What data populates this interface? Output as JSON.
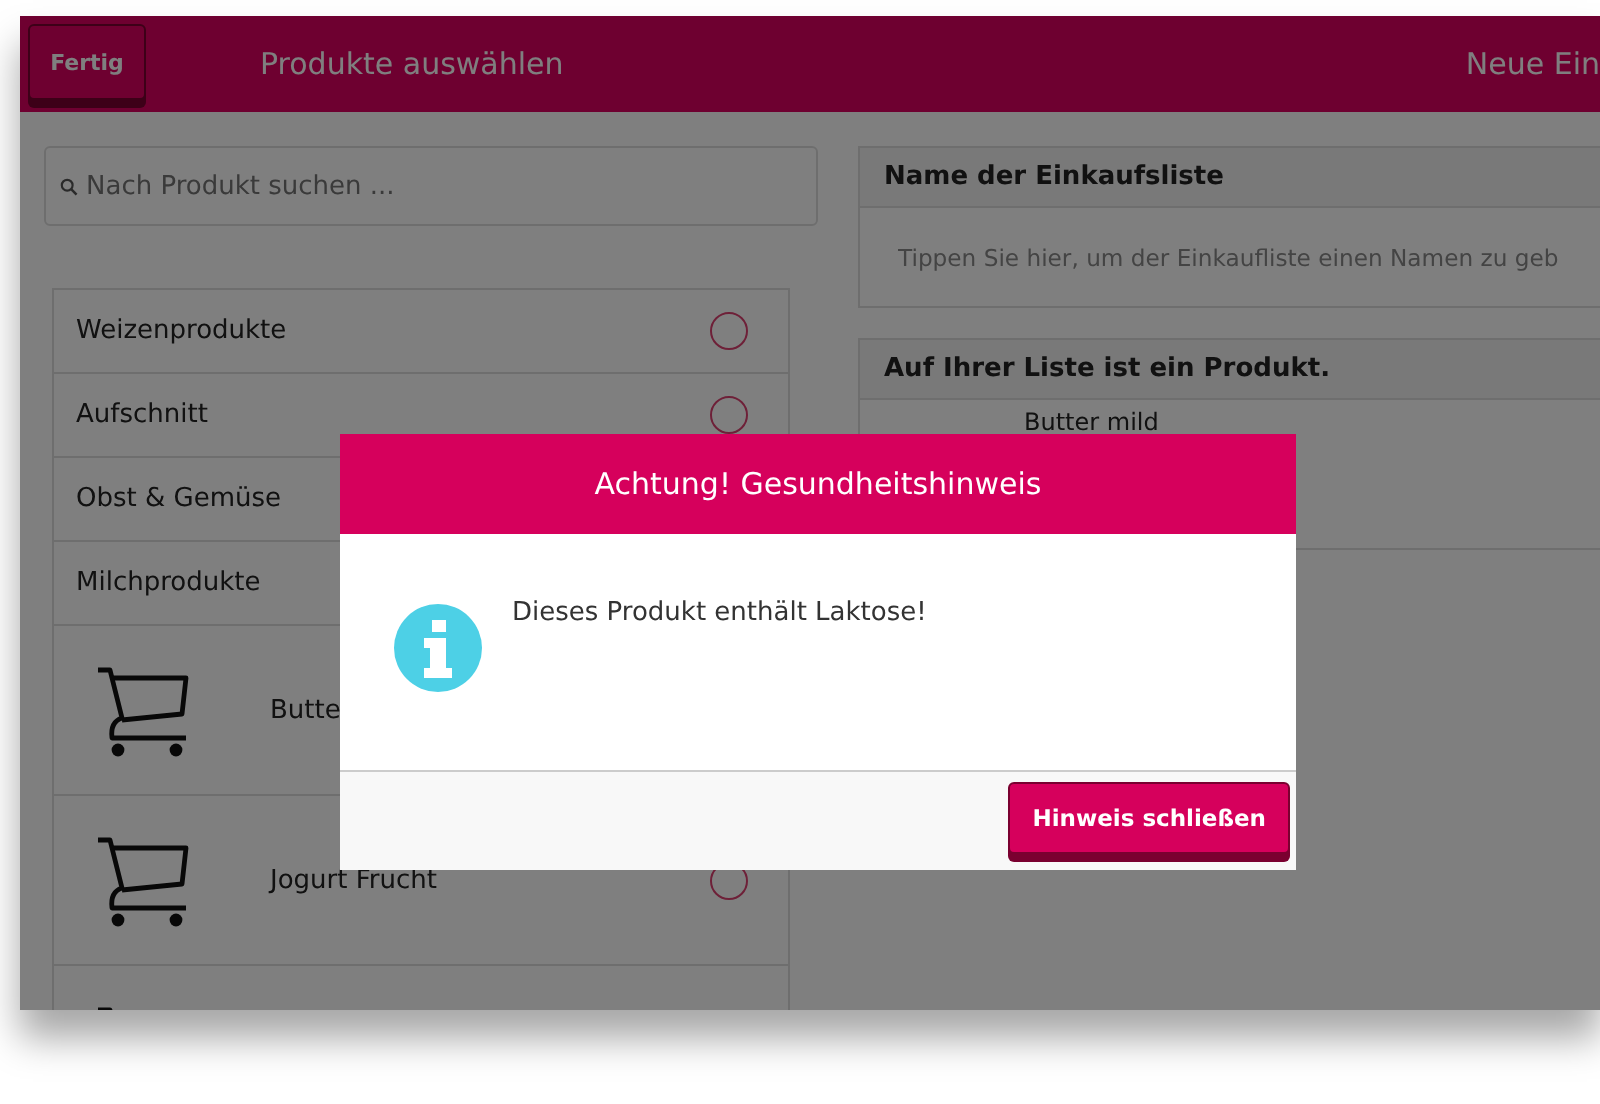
{
  "header": {
    "done_button": "Fertig",
    "title": "Produkte auswählen",
    "right_title": "Neue Ein"
  },
  "search": {
    "placeholder": "Nach Produkt suchen ..."
  },
  "list": [
    {
      "kind": "category",
      "label": "Weizenprodukte",
      "checked": false
    },
    {
      "kind": "category",
      "label": "Aufschnitt",
      "checked": false
    },
    {
      "kind": "category",
      "label": "Obst & Gemüse"
    },
    {
      "kind": "category",
      "label": "Milchprodukte"
    },
    {
      "kind": "product",
      "label": "Butte"
    },
    {
      "kind": "product",
      "label": "Jogurt Frucht",
      "checked": false
    },
    {
      "kind": "product"
    }
  ],
  "name_panel": {
    "heading": "Name der Einkaufsliste",
    "placeholder": "Tippen Sie hier, um der Einkaufliste einen Namen zu geb"
  },
  "list_panel": {
    "heading": "Auf Ihrer Liste ist ein Produkt.",
    "items": [
      "Butter mild"
    ]
  },
  "dialog": {
    "title": "Achtung! Gesundheitshinweis",
    "message": "Dieses Produkt enthält Laktose!",
    "button": "Hinweis schließen"
  }
}
